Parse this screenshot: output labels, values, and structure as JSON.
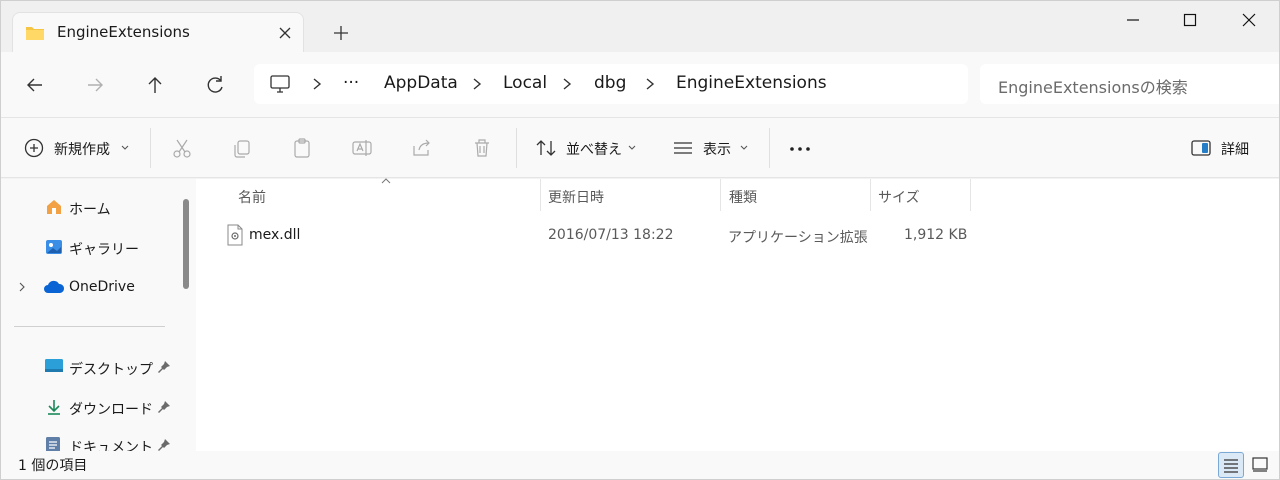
{
  "window": {
    "tab_title": "EngineExtensions",
    "controls": [
      "minimize",
      "maximize",
      "close"
    ]
  },
  "address": {
    "breadcrumbs": [
      "AppData",
      "Local",
      "dbg",
      "EngineExtensions"
    ],
    "overflow": "···",
    "search_placeholder": "EngineExtensionsの検索"
  },
  "toolbar": {
    "new_label": "新規作成",
    "sort_label": "並べ替え",
    "view_label": "表示",
    "more_label": "···",
    "details_label": "詳細"
  },
  "sidebar": {
    "items": [
      {
        "label": "ホーム",
        "icon": "home-icon"
      },
      {
        "label": "ギャラリー",
        "icon": "gallery-icon"
      },
      {
        "label": "OneDrive",
        "icon": "onedrive-icon"
      },
      {
        "label": "デスクトップ",
        "icon": "desktop-icon"
      },
      {
        "label": "ダウンロード",
        "icon": "download-icon"
      },
      {
        "label": "ドキュメント",
        "icon": "documents-icon"
      }
    ]
  },
  "file_list": {
    "columns": [
      "名前",
      "更新日時",
      "種類",
      "サイズ"
    ],
    "rows": [
      {
        "name": "mex.dll",
        "modified": "2016/07/13 18:22",
        "type": "アプリケーション拡張",
        "size": "1,912 KB"
      }
    ]
  },
  "status": {
    "item_count": "1 個の項目"
  },
  "colors": {
    "accent": "#0067c0",
    "folder": "#f6c544"
  }
}
